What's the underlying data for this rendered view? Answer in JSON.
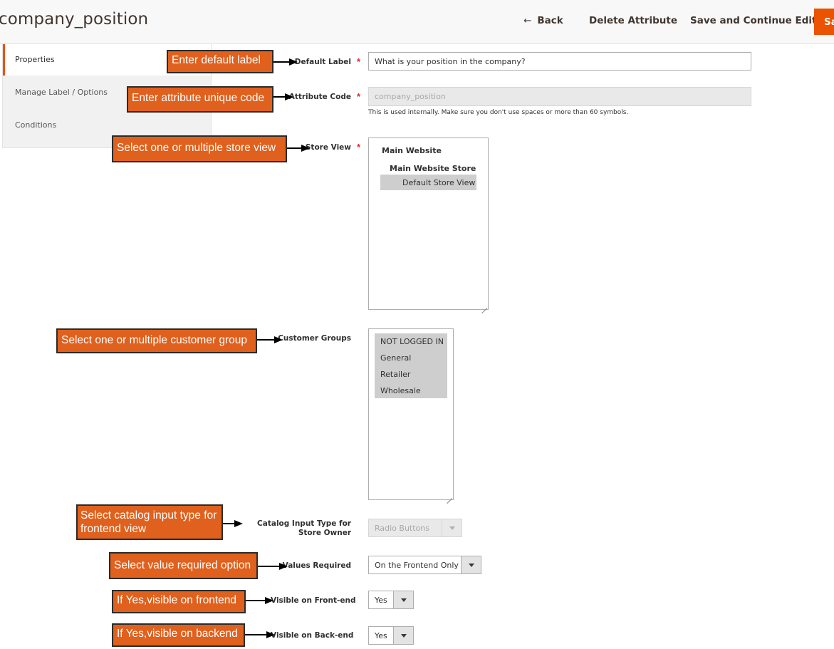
{
  "header": {
    "title": "company_position",
    "back_label": "Back",
    "delete_label": "Delete Attribute",
    "save_continue_label": "Save and Continue Edit",
    "save_label": "Save Attribute"
  },
  "tabs": [
    {
      "label": "Properties",
      "active": true
    },
    {
      "label": "Manage Label / Options",
      "active": false
    },
    {
      "label": "Conditions",
      "active": false
    }
  ],
  "form": {
    "default_label": {
      "label": "Default Label",
      "value": "What is your position in the company?",
      "required": true
    },
    "attribute_code": {
      "label": "Attribute Code",
      "value": "company_position",
      "required": true,
      "disabled": true,
      "note": "This is used internally. Make sure you don't use spaces or more than 60 symbols."
    },
    "store_view": {
      "label": "Store View",
      "required": true,
      "options": [
        {
          "text": "Main Website",
          "kind": "website"
        },
        {
          "text": "Main Website Store",
          "kind": "store"
        },
        {
          "text": "Default Store View",
          "kind": "view",
          "selected": true
        }
      ]
    },
    "customer_groups": {
      "label": "Customer Groups",
      "options": [
        {
          "text": "NOT LOGGED IN",
          "selected": true
        },
        {
          "text": "General",
          "selected": true
        },
        {
          "text": "Retailer",
          "selected": true
        },
        {
          "text": "Wholesale",
          "selected": true
        }
      ]
    },
    "catalog_input_type": {
      "label": "Catalog Input Type for Store Owner",
      "value": "Radio Buttons",
      "disabled": true
    },
    "values_required": {
      "label": "Values Required",
      "value": "On the Frontend Only"
    },
    "visible_frontend": {
      "label": "Visible on Front-end",
      "value": "Yes"
    },
    "visible_backend": {
      "label": "Visible on Back-end",
      "value": "Yes"
    }
  },
  "callouts": {
    "default_label": "Enter default label",
    "attribute_code": "Enter attribute unique code",
    "store_view": "Select one or multiple store view",
    "customer_groups": "Select one or multiple customer group",
    "catalog_input_type": "Select catalog input type for frontend view",
    "values_required": "Select value required option",
    "visible_frontend": "If Yes,visible on frontend",
    "visible_backend": "If Yes,visible on backend"
  },
  "colors": {
    "accent": "#eb5202",
    "callout": "#e0601d",
    "required": "#e22626"
  },
  "icons": {
    "back": "arrow-left-icon",
    "select": "chevron-down-icon"
  }
}
